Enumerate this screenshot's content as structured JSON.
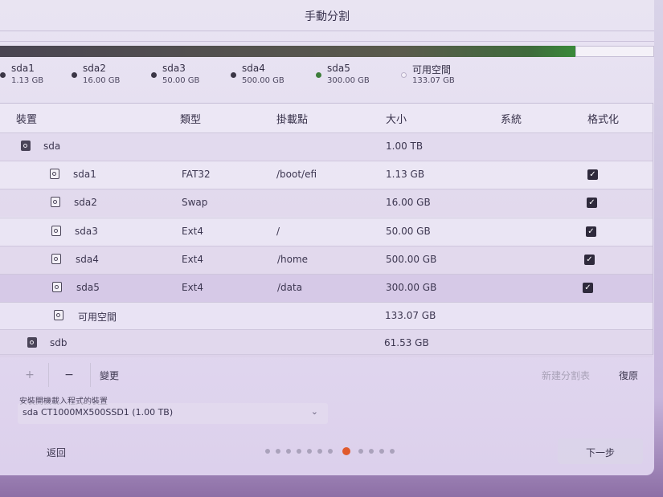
{
  "window": {
    "title": "手動分割"
  },
  "legend": [
    {
      "name": "sda1",
      "size": "1.13 GB",
      "dot": "dark"
    },
    {
      "name": "sda2",
      "size": "16.00 GB",
      "dot": "dark"
    },
    {
      "name": "sda3",
      "size": "50.00 GB",
      "dot": "dark"
    },
    {
      "name": "sda4",
      "size": "500.00 GB",
      "dot": "dark"
    },
    {
      "name": "sda5",
      "size": "300.00 GB",
      "dot": "green"
    },
    {
      "name": "可用空間",
      "size": "133.07 GB",
      "dot": "free"
    }
  ],
  "table": {
    "headers": {
      "device": "裝置",
      "type": "類型",
      "mount": "掛載點",
      "size": "大小",
      "system": "系統",
      "format": "格式化"
    },
    "rows": [
      {
        "device": "sda",
        "type": "",
        "mount": "",
        "size": "1.00 TB",
        "format": false
      },
      {
        "device": "sda1",
        "type": "FAT32",
        "mount": "/boot/efi",
        "size": "1.13 GB",
        "format": true
      },
      {
        "device": "sda2",
        "type": "Swap",
        "mount": "",
        "size": "16.00 GB",
        "format": true
      },
      {
        "device": "sda3",
        "type": "Ext4",
        "mount": "/",
        "size": "50.00 GB",
        "format": true
      },
      {
        "device": "sda4",
        "type": "Ext4",
        "mount": "/home",
        "size": "500.00 GB",
        "format": true
      },
      {
        "device": "sda5",
        "type": "Ext4",
        "mount": "/data",
        "size": "300.00 GB",
        "format": true
      },
      {
        "device": "可用空間",
        "type": "",
        "mount": "",
        "size": "133.07 GB",
        "format": false
      },
      {
        "device": "sdb",
        "type": "",
        "mount": "",
        "size": "61.53 GB",
        "format": false
      }
    ]
  },
  "toolbar": {
    "add_label": "+",
    "remove_label": "−",
    "change_label": "變更",
    "new_table_label": "新建分割表",
    "revert_label": "復原"
  },
  "boot_loader": {
    "label": "安裝開機載入程式的裝置",
    "value": "sda CT1000MX500SSD1 (1.00 TB)",
    "chevron": "⌄"
  },
  "footer": {
    "back_label": "返回",
    "next_label": "下一步",
    "steps_total": 11,
    "steps_current": 7
  },
  "colors": {
    "accent": "#e05a2c",
    "used_green": "#3e7d3b"
  }
}
